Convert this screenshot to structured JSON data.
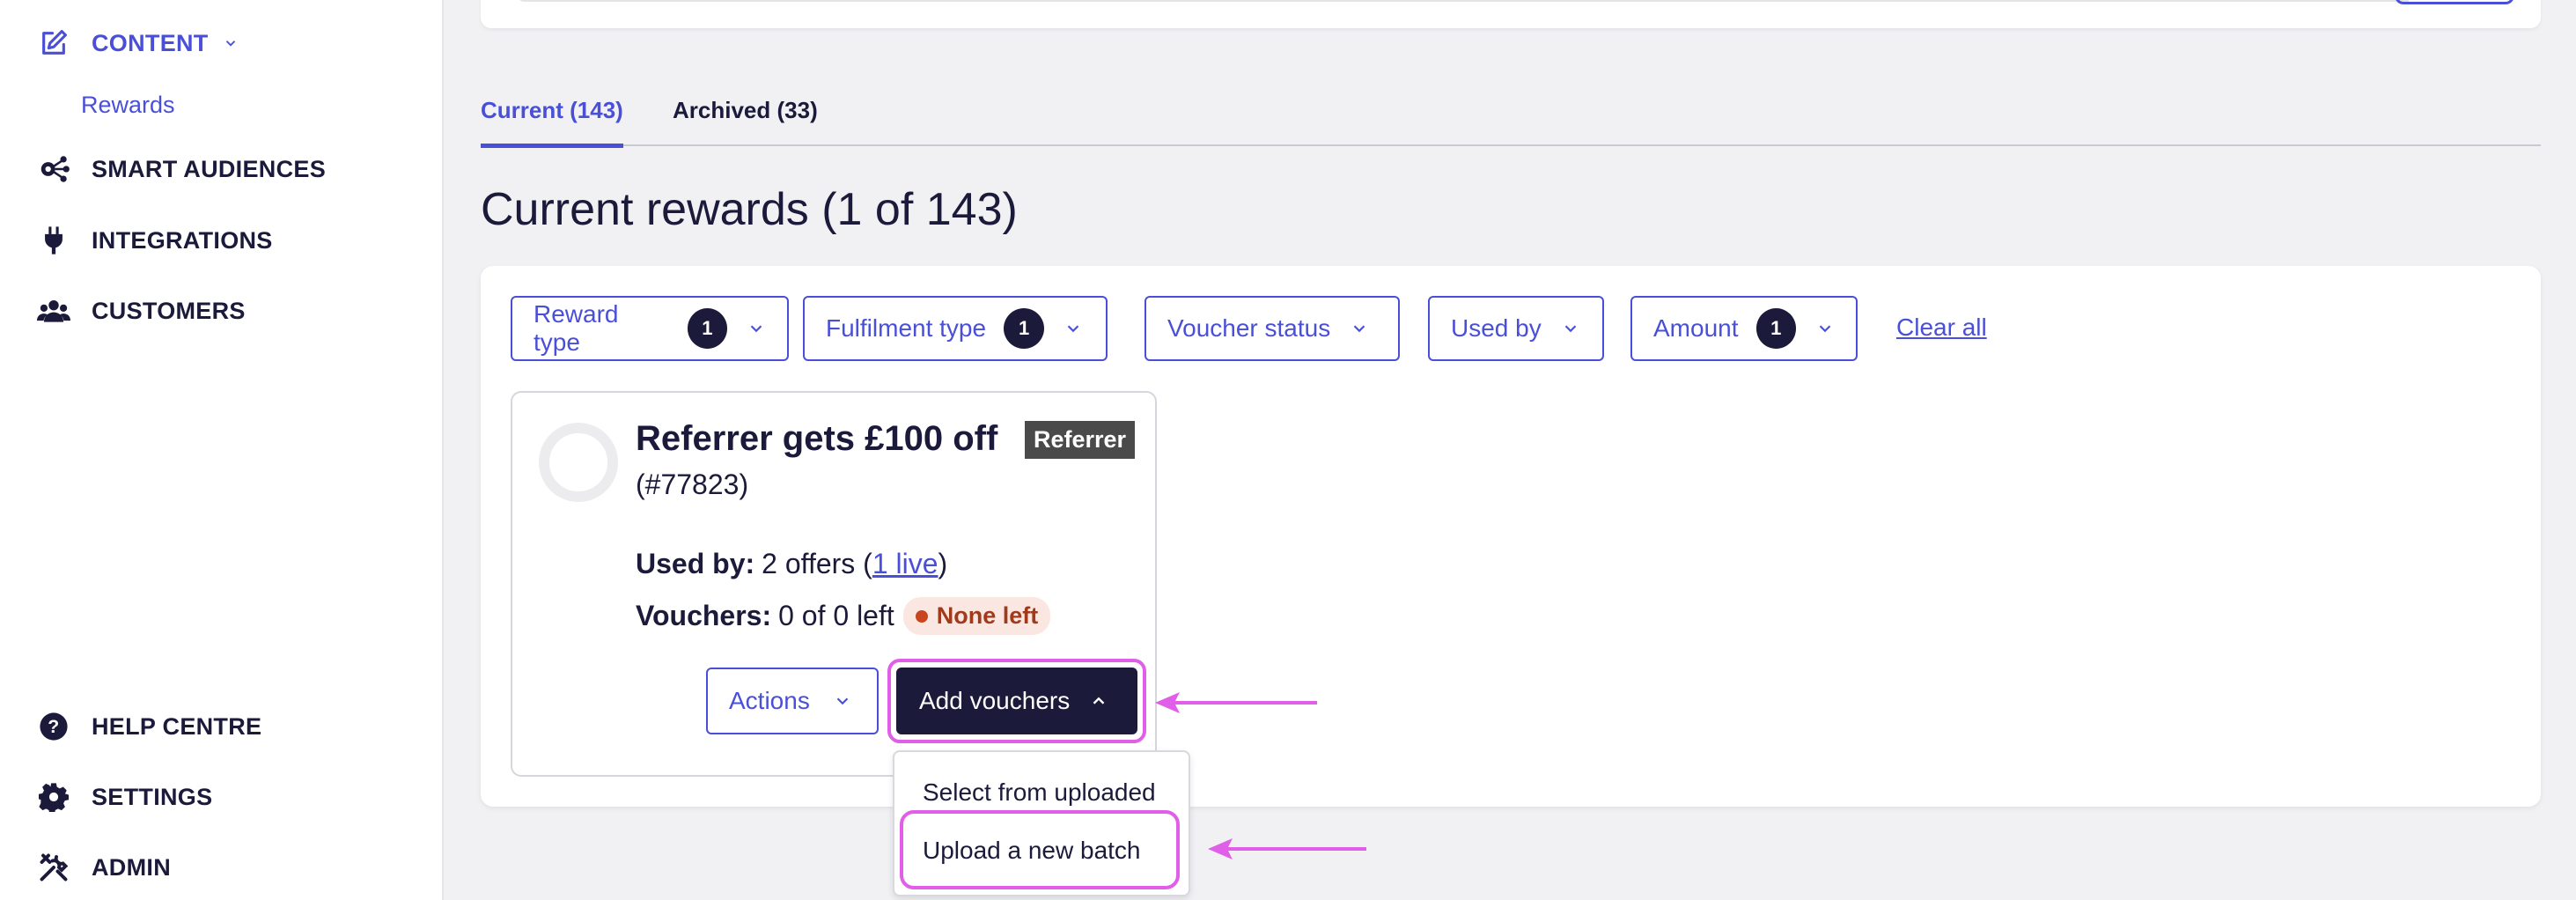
{
  "sidebar": {
    "content_label": "CONTENT",
    "rewards_label": "Rewards",
    "smart_audiences_label": "SMART AUDIENCES",
    "integrations_label": "INTEGRATIONS",
    "customers_label": "CUSTOMERS",
    "help_centre_label": "HELP CENTRE",
    "settings_label": "SETTINGS",
    "admin_label": "ADMIN"
  },
  "tabs": {
    "current_label": "Current (143)",
    "archived_label": "Archived (33)"
  },
  "page_title": "Current rewards (1 of 143)",
  "filters": [
    {
      "label": "Reward type",
      "count": "1"
    },
    {
      "label": "Fulfilment type",
      "count": "1"
    },
    {
      "label": "Voucher status",
      "count": null
    },
    {
      "label": "Used by",
      "count": null
    },
    {
      "label": "Amount",
      "count": "1"
    }
  ],
  "clear_all_label": "Clear all",
  "reward": {
    "title": "Referrer gets £100 off",
    "id": "(#77823)",
    "tag": "Referrer",
    "used_by_label": "Used by:",
    "used_by_offers": "2 offers (",
    "used_by_live_link": "1 live",
    "used_by_close": ")",
    "vouchers_label": "Vouchers:",
    "vouchers_value": "0 of 0 left",
    "status_badge": "None left"
  },
  "actions_label": "Actions",
  "add_vouchers_label": "Add vouchers",
  "dropdown": {
    "select_from_uploaded": "Select from uploaded",
    "upload_new_batch": "Upload a new batch"
  },
  "colors": {
    "accent": "#4a4fd8",
    "dark": "#1b1a3a",
    "highlight": "#e05ee8",
    "danger": "#c9451f"
  }
}
